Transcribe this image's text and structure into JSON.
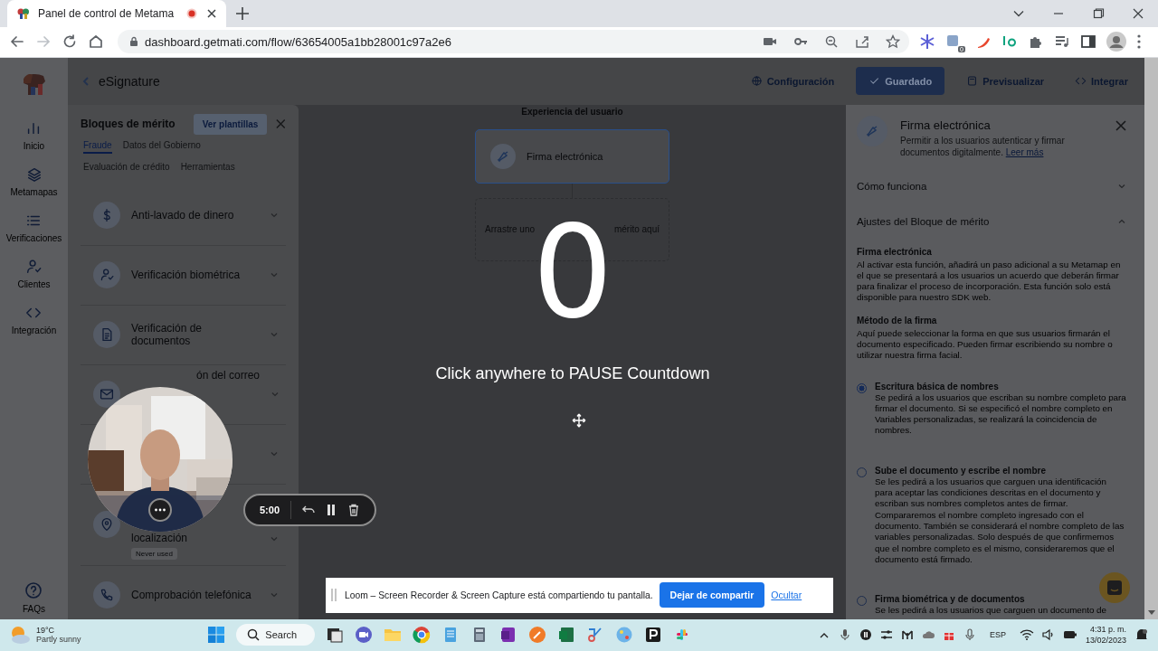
{
  "browser": {
    "tab": {
      "title": "Panel de control de Metama",
      "recording": true
    },
    "url": "dashboard.getmati.com/flow/63654005a1bb28001c97a2e6",
    "extension_badge": "0"
  },
  "nav": {
    "items": [
      {
        "kind": "chart",
        "label": "Inicio"
      },
      {
        "kind": "layers",
        "label": "Metamapas"
      },
      {
        "kind": "list",
        "label": "Verificaciones"
      },
      {
        "kind": "user",
        "label": "Clientes"
      },
      {
        "kind": "code",
        "label": "Integración"
      }
    ],
    "help": {
      "label": "FAQs"
    }
  },
  "header": {
    "title": "eSignature",
    "actions": [
      {
        "kind": "globe",
        "label": "Configuración"
      },
      {
        "kind": "check",
        "label": "Guardado",
        "primary": true
      },
      {
        "kind": "preview",
        "label": "Previsualizar"
      },
      {
        "kind": "code",
        "label": "Integrar"
      }
    ]
  },
  "blocks_panel": {
    "title": "Bloques de mérito",
    "templates_button": "Ver plantillas",
    "tabs": [
      {
        "label": "Fraude",
        "selected": true
      },
      {
        "label": "Datos del Gobierno",
        "selected": false
      },
      {
        "label": "Evaluación de crédito",
        "selected": false
      },
      {
        "label": "Herramientas",
        "selected": false
      }
    ],
    "items": [
      {
        "kind": "full",
        "title": "Anti-lavado de dinero"
      },
      {
        "kind": "full",
        "title": "Verificación biométrica"
      },
      {
        "kind": "full",
        "title": "Verificación de documentos"
      },
      {
        "kind": "covered_start",
        "title": "ón del correo"
      },
      {
        "kind": "hidden"
      },
      {
        "kind": "covered_top",
        "title": "localización",
        "badge": "Never used"
      },
      {
        "kind": "full",
        "title": "Comprobación telefónica"
      }
    ]
  },
  "canvas": {
    "label": "Experiencia del usuario",
    "node": {
      "title": "Firma electrónica",
      "selected": true
    },
    "drop_zone": {
      "texts": [
        "Arrastre uno",
        "mérito aquí"
      ]
    }
  },
  "countdown": {
    "number": "0",
    "message": "Click anywhere to PAUSE Countdown"
  },
  "settings_panel": {
    "title": "Firma electrónica",
    "description": "Permitir a los usuarios autenticar y firmar documentos digitalmente.",
    "link": "Leer más",
    "sections": [
      {
        "title": "Cómo funciona",
        "expanded": false
      },
      {
        "title": "Ajustes del Bloque de mérito",
        "expanded": true
      }
    ],
    "feature_title": "Firma electrónica",
    "feature_text": "Al activar esta función, añadirá un paso adicional a su Metamap en el que se presentará a los usuarios un acuerdo que deberán firmar para finalizar el proceso de incorporación. Esta función solo está disponible para nuestro SDK web.",
    "method_title": "Método de la firma",
    "method_text": "Aquí puede seleccionar la forma en que sus usuarios firmarán el documento especificado. Pueden firmar escribiendo su nombre o utilizar nuestra firma facial.",
    "options": [
      {
        "label": "Escritura básica de nombres",
        "text": "Se pedirá a los usuarios que escriban su nombre completo para firmar el documento. Si se especificó el nombre completo en Variables personalizadas, se realizará la coincidencia de nombres.",
        "selected": true
      },
      {
        "label": "Sube el documento y escribe el nombre",
        "text": "Se les pedirá a los usuarios que carguen una identificación para aceptar las condiciones descritas en el documento y escriban sus nombres completos antes de firmar. Compararemos el nombre completo ingresado con el documento. También se considerará el nombre completo de las variables personalizadas. Solo después de que confirmemos que el nombre completo es el mismo, consideraremos que el documento está firmado.",
        "selected": false
      },
      {
        "label": "Firma biométrica y de documentos",
        "text": "Se les pedirá a los usuarios que carguen un documento de",
        "selected": false
      }
    ]
  },
  "recorder": {
    "timer": "5:00"
  },
  "share_bar": {
    "message": "Loom – Screen Recorder & Screen Capture está compartiendo tu pantalla.",
    "stop_button": "Dejar de compartir",
    "hide_link": "Ocultar"
  },
  "taskbar": {
    "weather": {
      "temperature": "19°C",
      "condition": "Partly sunny"
    },
    "search": "Search",
    "language": "ESP",
    "time": "4:31 p. m.",
    "date": "13/02/2023"
  }
}
